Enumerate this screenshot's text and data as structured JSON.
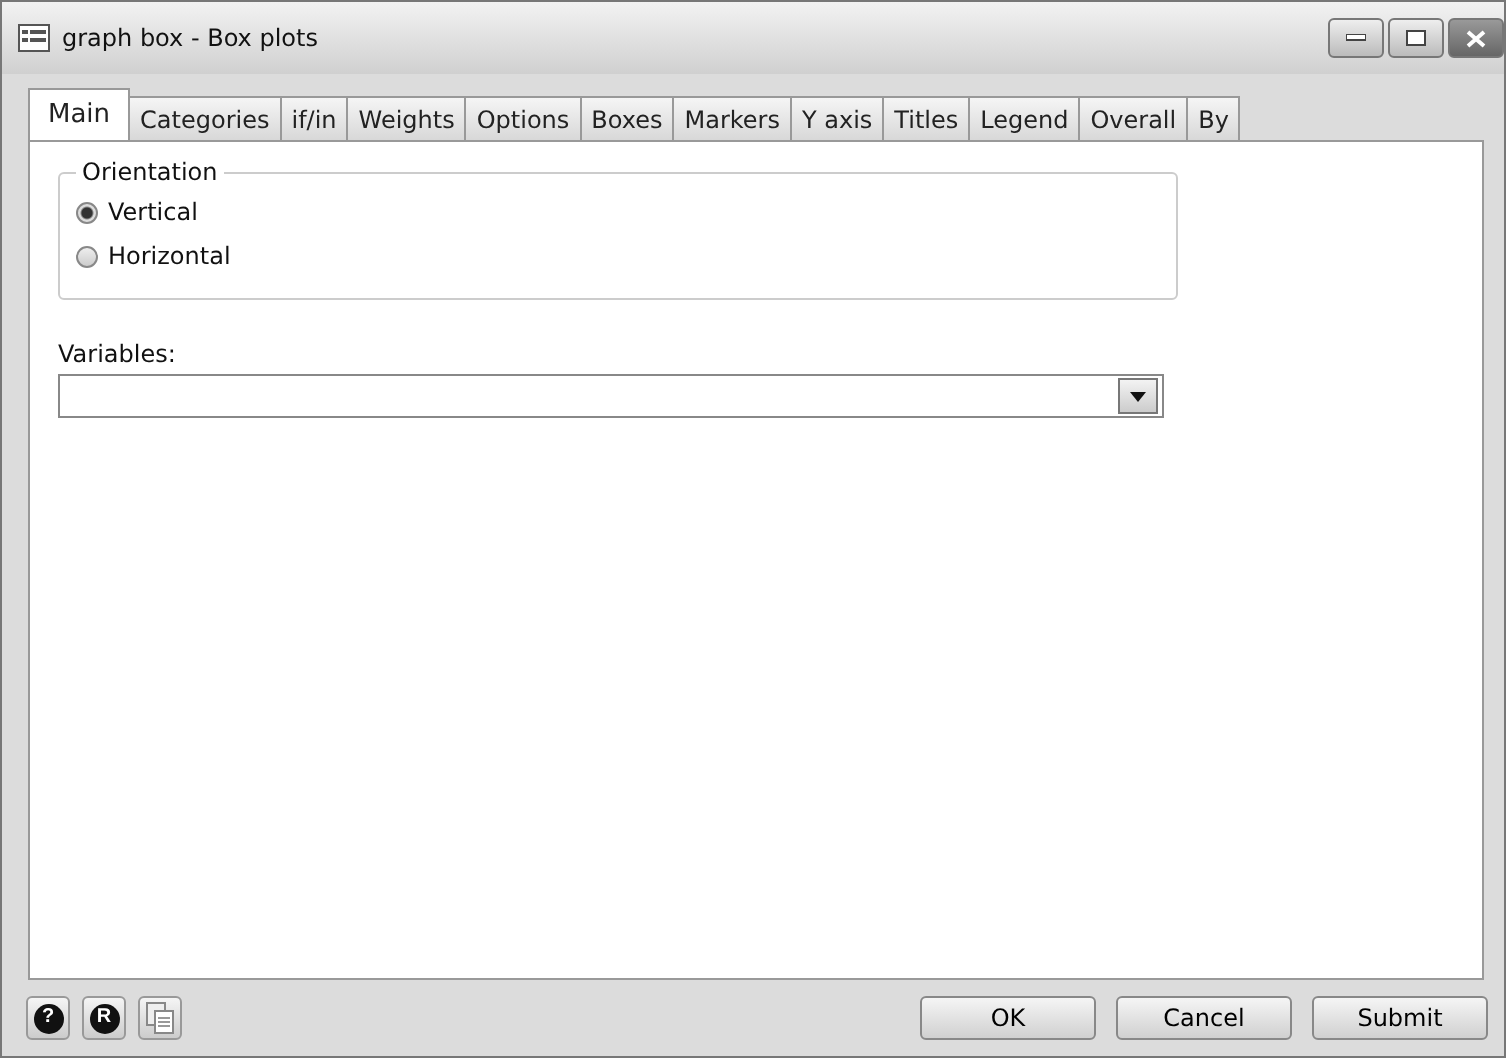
{
  "window": {
    "title": "graph box - Box plots"
  },
  "tabs": [
    {
      "label": "Main",
      "selected": true
    },
    {
      "label": "Categories",
      "selected": false
    },
    {
      "label": "if/in",
      "selected": false
    },
    {
      "label": "Weights",
      "selected": false
    },
    {
      "label": "Options",
      "selected": false
    },
    {
      "label": "Boxes",
      "selected": false
    },
    {
      "label": "Markers",
      "selected": false
    },
    {
      "label": "Y axis",
      "selected": false
    },
    {
      "label": "Titles",
      "selected": false
    },
    {
      "label": "Legend",
      "selected": false
    },
    {
      "label": "Overall",
      "selected": false
    },
    {
      "label": "By",
      "selected": false
    }
  ],
  "orientation": {
    "legend": "Orientation",
    "options": [
      {
        "label": "Vertical",
        "selected": true
      },
      {
        "label": "Horizontal",
        "selected": false
      }
    ]
  },
  "variables": {
    "label": "Variables:"
  },
  "footer": {
    "icon_buttons": [
      {
        "kind": "help",
        "label": "?"
      },
      {
        "kind": "reset",
        "label": "R"
      },
      {
        "kind": "copy"
      }
    ],
    "buttons": [
      "OK",
      "Cancel",
      "Submit"
    ]
  }
}
